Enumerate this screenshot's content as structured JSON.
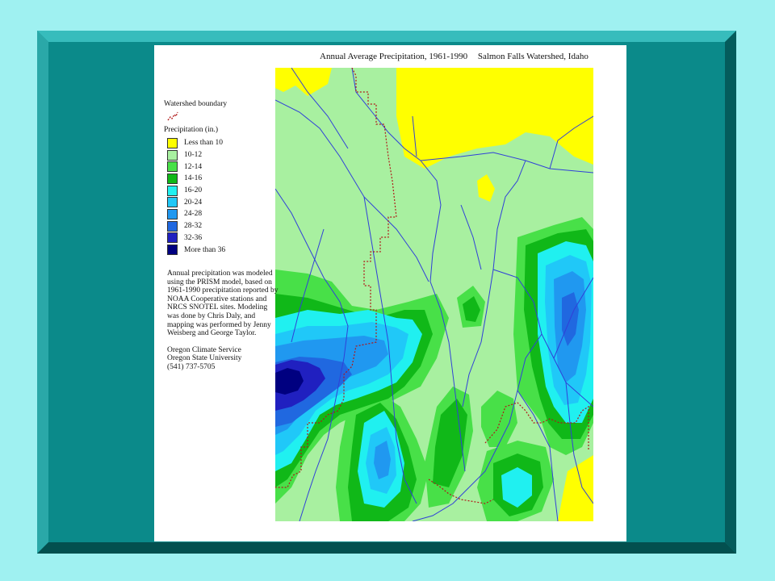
{
  "slide": {
    "colors": {
      "background": "#9ff1f1",
      "frame": "#0b8a8a",
      "frame_highlight": "#37bcbc",
      "frame_shadow": "#045c5c",
      "panel": "#ffffff"
    }
  },
  "map": {
    "title": "Annual Average Precipitation, 1961-1990",
    "region": "Salmon Falls Watershed, Idaho",
    "colors": {
      "river": "#3040d8",
      "boundary": "#b01818"
    }
  },
  "legend": {
    "boundary_label": "Watershed boundary",
    "precip_heading": "Precipitation (in.)",
    "items": [
      {
        "label": "Less than 10",
        "color": "#ffff00"
      },
      {
        "label": "10-12",
        "color": "#a8f0a0"
      },
      {
        "label": "12-14",
        "color": "#48e048"
      },
      {
        "label": "14-16",
        "color": "#10b818"
      },
      {
        "label": "16-20",
        "color": "#20f0f0"
      },
      {
        "label": "20-24",
        "color": "#20c8f8"
      },
      {
        "label": "24-28",
        "color": "#2098f0"
      },
      {
        "label": "28-32",
        "color": "#2068e0"
      },
      {
        "label": "32-36",
        "color": "#2020c0"
      },
      {
        "label": "More than 36",
        "color": "#000080"
      }
    ]
  },
  "notes": {
    "description": "Annual precipitation was modeled using the PRISM model, based on 1961-1990 precipitation reported by NOAA Cooperative stations and NRCS SNOTEL sites. Modeling was done by Chris Daly, and mapping was performed by Jenny Weisberg and George Taylor.",
    "credits": [
      "Oregon Climate Service",
      "Oregon State University",
      "(541) 737-5705"
    ]
  }
}
